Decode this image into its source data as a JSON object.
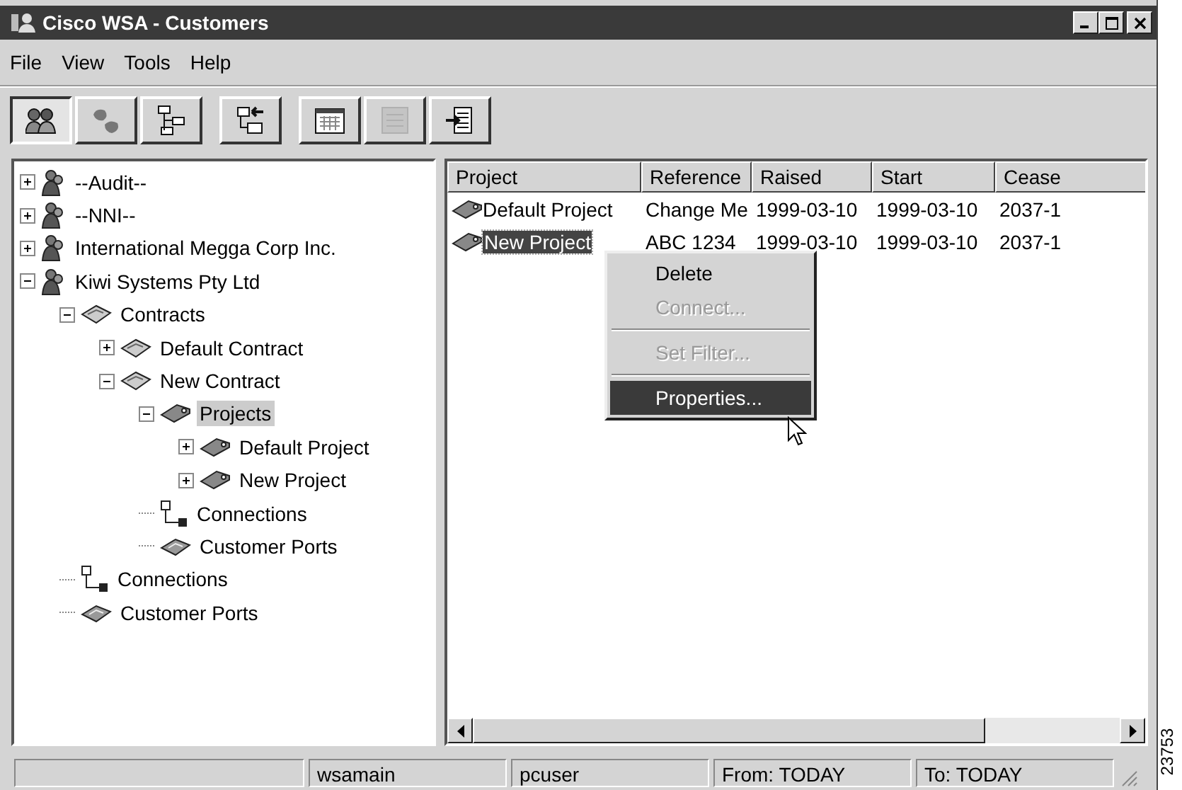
{
  "window": {
    "title": "Cisco WSA - Customers"
  },
  "menu": [
    "File",
    "View",
    "Tools",
    "Help"
  ],
  "toolbar": [
    [
      {
        "kind": "people",
        "selected": true,
        "disabled": false
      },
      {
        "kind": "blobs",
        "selected": false,
        "disabled": false
      },
      {
        "kind": "hierarchy",
        "selected": false,
        "disabled": false
      }
    ],
    [
      {
        "kind": "folders",
        "selected": false,
        "disabled": false
      }
    ],
    [
      {
        "kind": "calendar",
        "selected": false,
        "disabled": false
      },
      {
        "kind": "sheet",
        "selected": false,
        "disabled": true
      },
      {
        "kind": "import",
        "selected": false,
        "disabled": false
      }
    ]
  ],
  "tree": [
    {
      "kind": "customer",
      "label": "--Audit--",
      "expanded": false,
      "selected": false
    },
    {
      "kind": "customer",
      "label": "--NNI--",
      "expanded": false,
      "selected": false
    },
    {
      "kind": "customer",
      "label": "International Megga Corp Inc.",
      "expanded": false,
      "selected": false
    },
    {
      "kind": "customer",
      "label": "Kiwi Systems Pty Ltd",
      "expanded": true,
      "selected": false,
      "children": [
        {
          "kind": "contract",
          "label": "Contracts",
          "expanded": true,
          "selected": false,
          "children": [
            {
              "kind": "contract",
              "label": "Default Contract",
              "expanded": false,
              "selected": false
            },
            {
              "kind": "contract",
              "label": "New Contract",
              "expanded": true,
              "selected": false,
              "children": [
                {
                  "kind": "project",
                  "label": "Projects",
                  "expanded": true,
                  "selected": true,
                  "children": [
                    {
                      "kind": "project",
                      "label": "Default Project",
                      "expanded": false,
                      "selected": false
                    },
                    {
                      "kind": "project",
                      "label": "New Project",
                      "expanded": false,
                      "selected": false
                    }
                  ]
                },
                {
                  "kind": "connections",
                  "label": "Connections",
                  "selected": false
                },
                {
                  "kind": "ports",
                  "label": "Customer Ports",
                  "selected": false
                }
              ]
            }
          ]
        },
        {
          "kind": "connections",
          "label": "Connections",
          "selected": false
        },
        {
          "kind": "ports",
          "label": "Customer Ports",
          "selected": false
        }
      ]
    }
  ],
  "table": {
    "columns": [
      "Project",
      "Reference",
      "Raised",
      "Start",
      "Cease"
    ],
    "rows": [
      {
        "selected": false,
        "cells": [
          "Default Project",
          "Change Me",
          "1999-03-10",
          "1999-03-10",
          "2037-1"
        ]
      },
      {
        "selected": true,
        "cells": [
          "New Project",
          "ABC 1234",
          "1999-03-10",
          "1999-03-10",
          "2037-1"
        ]
      }
    ]
  },
  "context_menu": [
    {
      "kind": "item",
      "label": "Delete",
      "disabled": false,
      "selected": false
    },
    {
      "kind": "item",
      "label": "Connect...",
      "disabled": true,
      "selected": false
    },
    {
      "kind": "separator"
    },
    {
      "kind": "item",
      "label": "Set Filter...",
      "disabled": true,
      "selected": false
    },
    {
      "kind": "separator"
    },
    {
      "kind": "item",
      "label": "Properties...",
      "disabled": false,
      "selected": true
    }
  ],
  "status_bar": [
    "wsamain",
    "pcuser",
    "From: TODAY",
    "To: TODAY"
  ],
  "figure_number": "23753"
}
